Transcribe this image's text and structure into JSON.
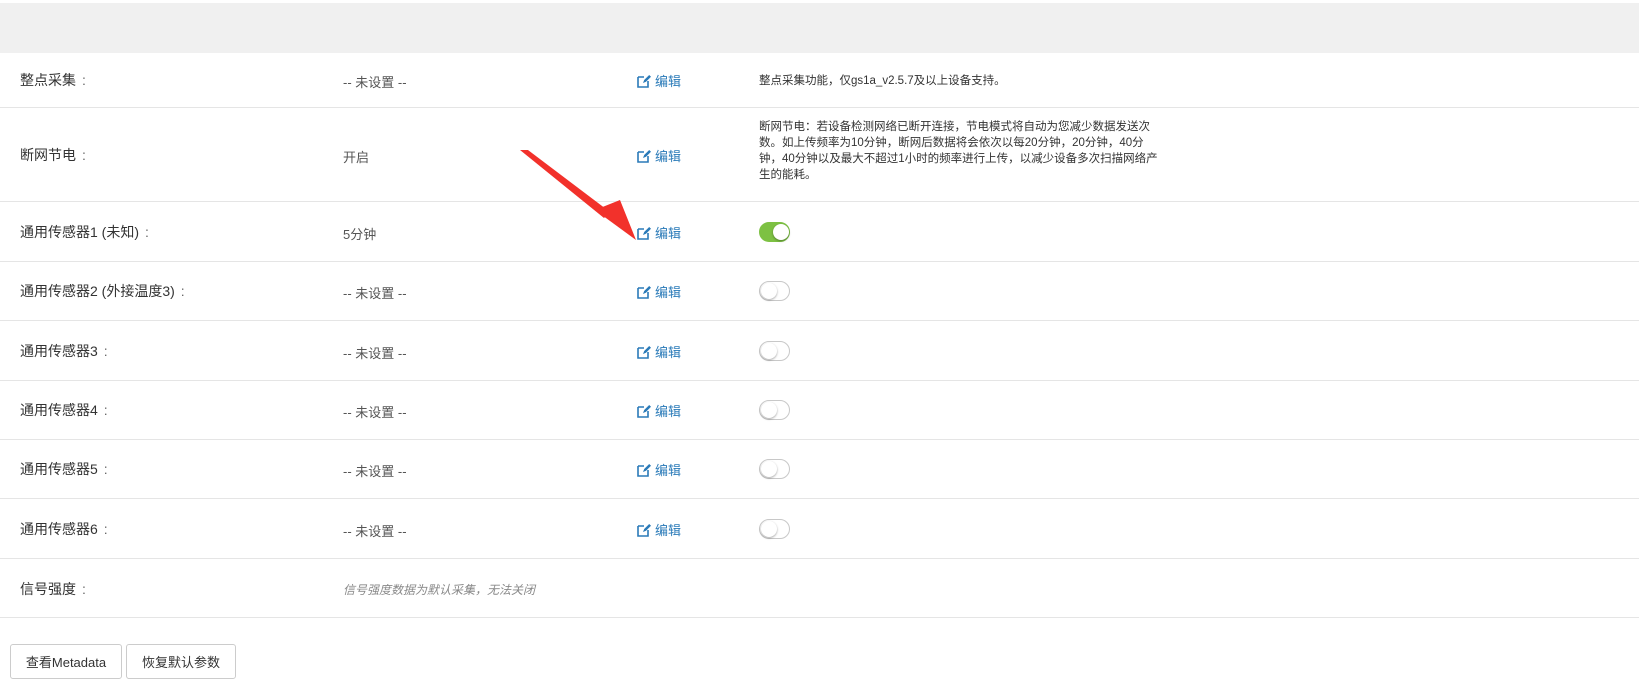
{
  "rows": [
    {
      "label": "整点采集",
      "colon": ":",
      "value": "-- 未设置 --",
      "edit": "编辑",
      "desc": "整点采集功能，仅gs1a_v2.5.7及以上设备支持。"
    },
    {
      "label": "断网节电",
      "colon": ":",
      "value": "开启",
      "edit": "编辑",
      "desc": "断网节电：若设备检测网络已断开连接，节电模式将自动为您减少数据发送次数。如上传频率为10分钟，断网后数据将会依次以每20分钟，20分钟，40分钟，40分钟以及最大不超过1小时的频率进行上传，以减少设备多次扫描网络产生的能耗。"
    },
    {
      "label": "通用传感器1 (未知)",
      "colon": ":",
      "value": "5分钟",
      "edit": "编辑",
      "toggle": true
    },
    {
      "label": "通用传感器2 (外接温度3)",
      "colon": ":",
      "value": "-- 未设置 --",
      "edit": "编辑",
      "toggle": false
    },
    {
      "label": "通用传感器3",
      "colon": ":",
      "value": "-- 未设置 --",
      "edit": "编辑",
      "toggle": false
    },
    {
      "label": "通用传感器4",
      "colon": ":",
      "value": "-- 未设置 --",
      "edit": "编辑",
      "toggle": false
    },
    {
      "label": "通用传感器5",
      "colon": ":",
      "value": "-- 未设置 --",
      "edit": "编辑",
      "toggle": false
    },
    {
      "label": "通用传感器6",
      "colon": ":",
      "value": "-- 未设置 --",
      "edit": "编辑",
      "toggle": false
    },
    {
      "label": "信号强度",
      "colon": ":",
      "value": "信号强度数据为默认采集，无法关闭"
    }
  ],
  "buttons": {
    "metadata": "查看Metadata",
    "restore": "恢复默认参数"
  },
  "colors": {
    "toggle_on": "#7dc143",
    "link": "#2a7ab8",
    "annotation_arrow": "#f2312b"
  },
  "icons": {
    "edit": "edit-icon"
  }
}
